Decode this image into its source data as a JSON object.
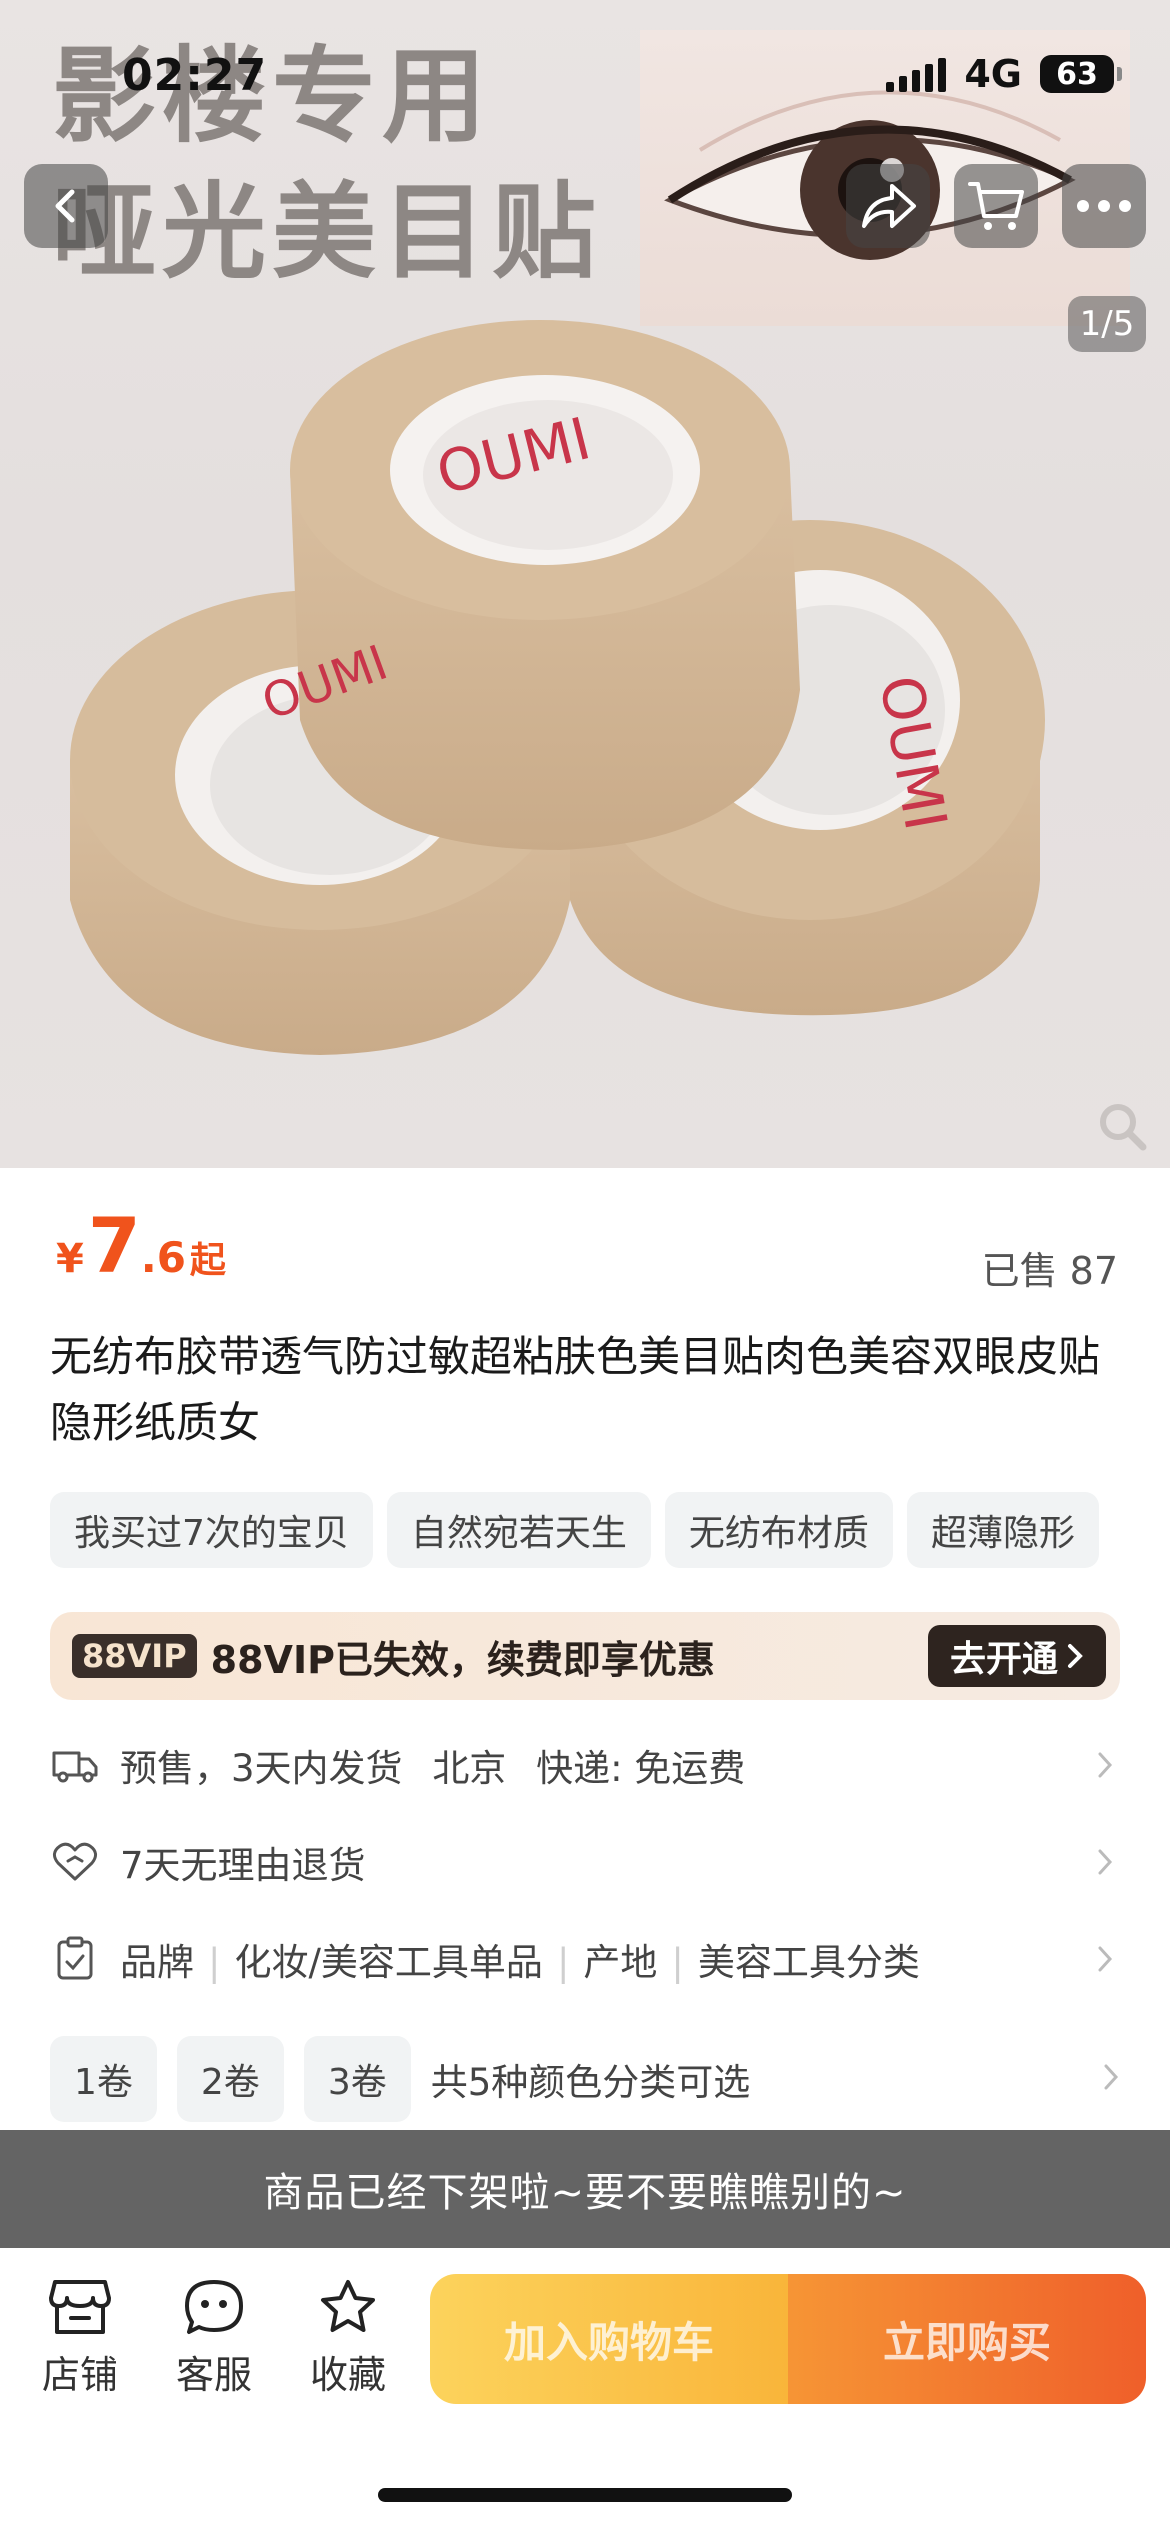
{
  "status_bar": {
    "time": "02:27",
    "network": "4G",
    "battery": "63"
  },
  "hero": {
    "text_line1": "影楼专用",
    "text_line2": "哑光美目贴",
    "image_counter": "1/5",
    "roll_brand": "OUMI"
  },
  "product": {
    "currency": "¥",
    "price_int": "7",
    "price_dec": ".6",
    "price_suffix": "起",
    "sold": "已售 87",
    "title": "无纺布胶带透气防过敏超粘肤色美目贴肉色美容双眼皮贴隐形纸质女",
    "tags": [
      "我买过7次的宝贝",
      "自然宛若天生",
      "无纺布材质",
      "超薄隐形"
    ]
  },
  "vip": {
    "badge": "88VIP",
    "text": "88VIP已失效，续费即享优惠",
    "button": "去开通"
  },
  "info": {
    "shipping": {
      "presale": "预售，3天内发货",
      "origin": "北京",
      "express": "快递: 免运费"
    },
    "returns": "7天无理由退货",
    "params": {
      "brand": "品牌",
      "category": "化妆/美容工具单品",
      "origin": "产地",
      "type": "美容工具分类"
    }
  },
  "sku": {
    "options": [
      "1卷",
      "2卷",
      "3卷"
    ],
    "note": "共5种颜色分类可选"
  },
  "offline_notice": "商品已经下架啦~要不要瞧瞧别的~",
  "bottom_bar": {
    "shop": "店铺",
    "service": "客服",
    "favorite": "收藏",
    "add_to_cart": "加入购物车",
    "buy_now": "立即购买"
  },
  "colors": {
    "accent": "#f0531c",
    "cart_button": "#f9b53a",
    "buy_button": "#ef5f2a",
    "offline_banner": "#646464"
  }
}
